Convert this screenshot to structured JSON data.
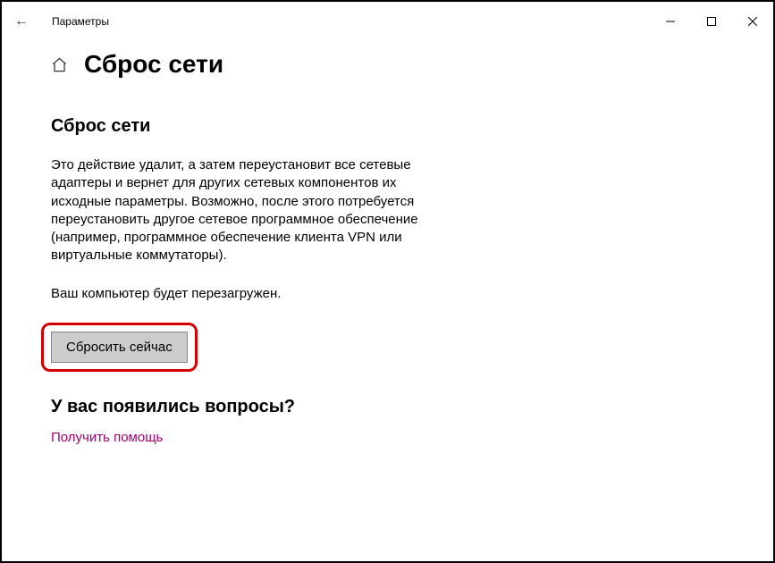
{
  "window": {
    "title": "Параметры"
  },
  "header": {
    "page_title": "Сброс сети"
  },
  "main": {
    "section_heading": "Сброс сети",
    "description": "Это действие удалит, а затем переустановит все сетевые адаптеры и вернет для других сетевых компонентов их исходные параметры. Возможно, после этого потребуется переустановить другое сетевое программное обеспечение (например, программное обеспечение клиента VPN или виртуальные коммутаторы).",
    "restart_note": "Ваш компьютер будет перезагружен.",
    "reset_button_label": "Сбросить сейчас"
  },
  "help": {
    "heading": "У вас появились вопросы?",
    "link_label": "Получить помощь"
  }
}
